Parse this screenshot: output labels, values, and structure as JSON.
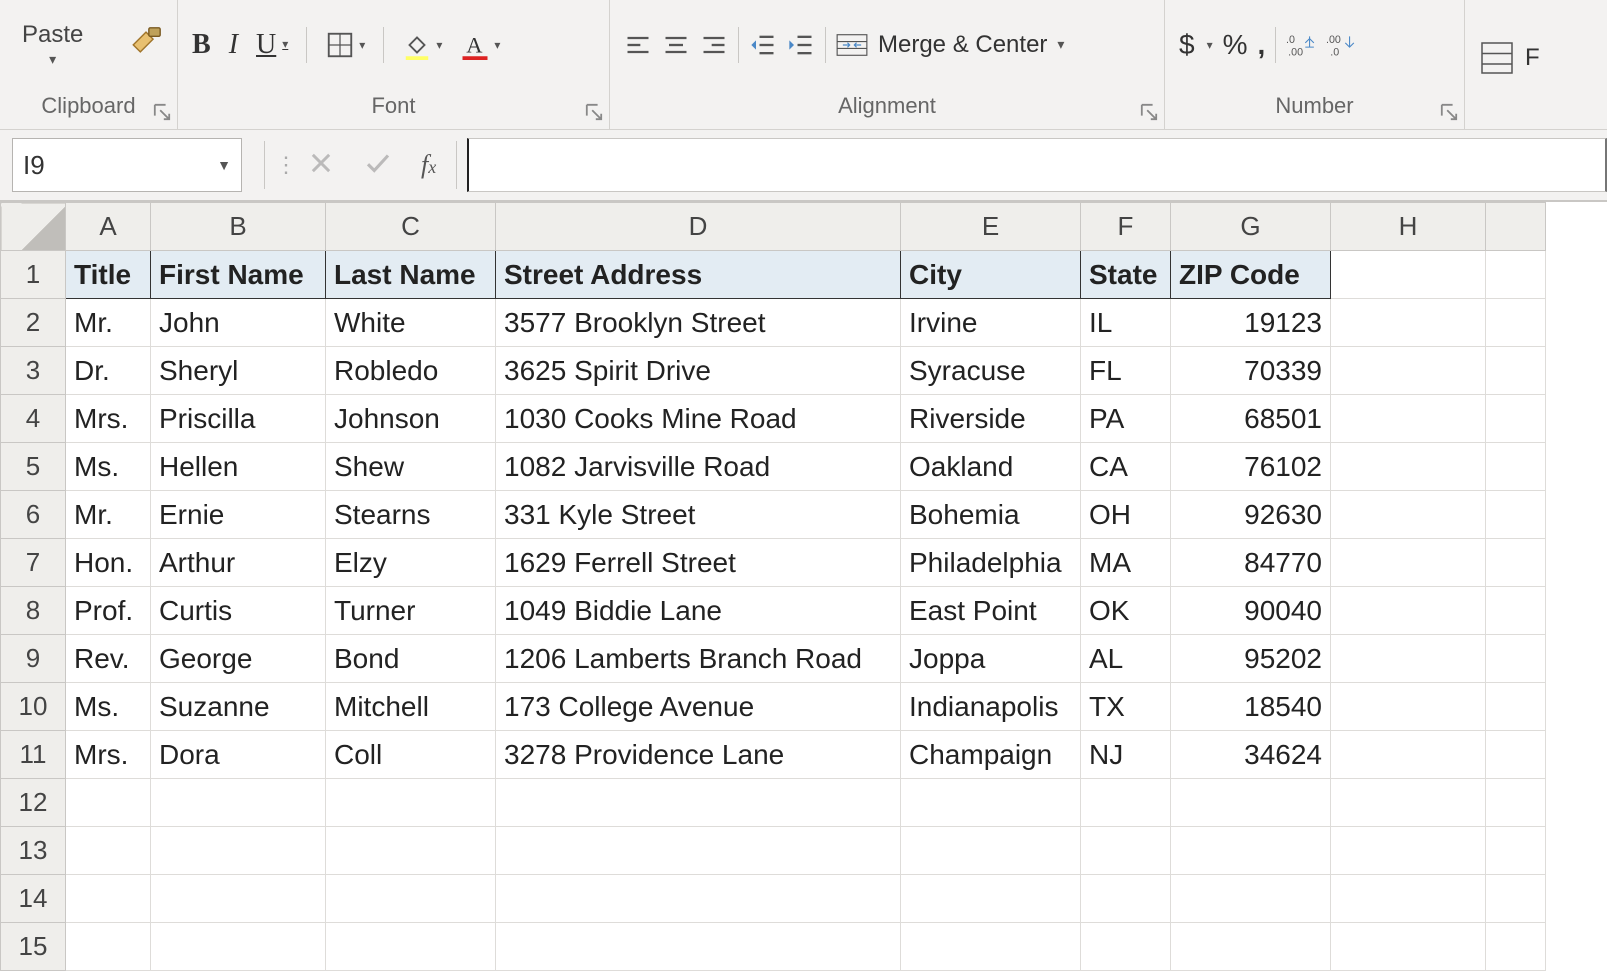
{
  "ribbon": {
    "clipboard": {
      "label": "Clipboard",
      "paste": "Paste"
    },
    "font": {
      "label": "Font"
    },
    "alignment": {
      "label": "Alignment",
      "merge": "Merge & Center"
    },
    "number": {
      "label": "Number",
      "currency": "$",
      "percent": "%",
      "comma": ","
    }
  },
  "namebox": "I9",
  "formula": "",
  "columns": [
    "A",
    "B",
    "C",
    "D",
    "E",
    "F",
    "G",
    "H"
  ],
  "row_numbers": [
    1,
    2,
    3,
    4,
    5,
    6,
    7,
    8,
    9,
    10,
    11,
    12,
    13,
    14,
    15
  ],
  "headers": [
    "Title",
    "First Name",
    "Last Name",
    "Street Address",
    "City",
    "State",
    "ZIP Code"
  ],
  "rows": [
    {
      "title": "Mr.",
      "first": "John",
      "last": "White",
      "street": "3577 Brooklyn Street",
      "city": "Irvine",
      "state": "IL",
      "zip": "19123"
    },
    {
      "title": "Dr.",
      "first": "Sheryl",
      "last": "Robledo",
      "street": "3625 Spirit Drive",
      "city": "Syracuse",
      "state": "FL",
      "zip": "70339"
    },
    {
      "title": "Mrs.",
      "first": "Priscilla",
      "last": "Johnson",
      "street": "1030 Cooks Mine Road",
      "city": "Riverside",
      "state": "PA",
      "zip": "68501"
    },
    {
      "title": "Ms.",
      "first": "Hellen",
      "last": "Shew",
      "street": "1082 Jarvisville Road",
      "city": "Oakland",
      "state": "CA",
      "zip": "76102"
    },
    {
      "title": "Mr.",
      "first": "Ernie",
      "last": "Stearns",
      "street": "331 Kyle Street",
      "city": "Bohemia",
      "state": "OH",
      "zip": "92630"
    },
    {
      "title": "Hon.",
      "first": "Arthur",
      "last": "Elzy",
      "street": "1629 Ferrell Street",
      "city": "Philadelphia",
      "state": "MA",
      "zip": "84770"
    },
    {
      "title": "Prof.",
      "first": "Curtis",
      "last": "Turner",
      "street": "1049 Biddie Lane",
      "city": "East Point",
      "state": "OK",
      "zip": "90040"
    },
    {
      "title": "Rev.",
      "first": "George",
      "last": "Bond",
      "street": "1206 Lamberts Branch Road",
      "city": "Joppa",
      "state": "AL",
      "zip": "95202"
    },
    {
      "title": "Ms.",
      "first": "Suzanne",
      "last": "Mitchell",
      "street": "173 College Avenue",
      "city": "Indianapolis",
      "state": "TX",
      "zip": "18540"
    },
    {
      "title": "Mrs.",
      "first": "Dora",
      "last": "Coll",
      "street": "3278 Providence Lane",
      "city": "Champaign",
      "state": "NJ",
      "zip": "34624"
    }
  ]
}
